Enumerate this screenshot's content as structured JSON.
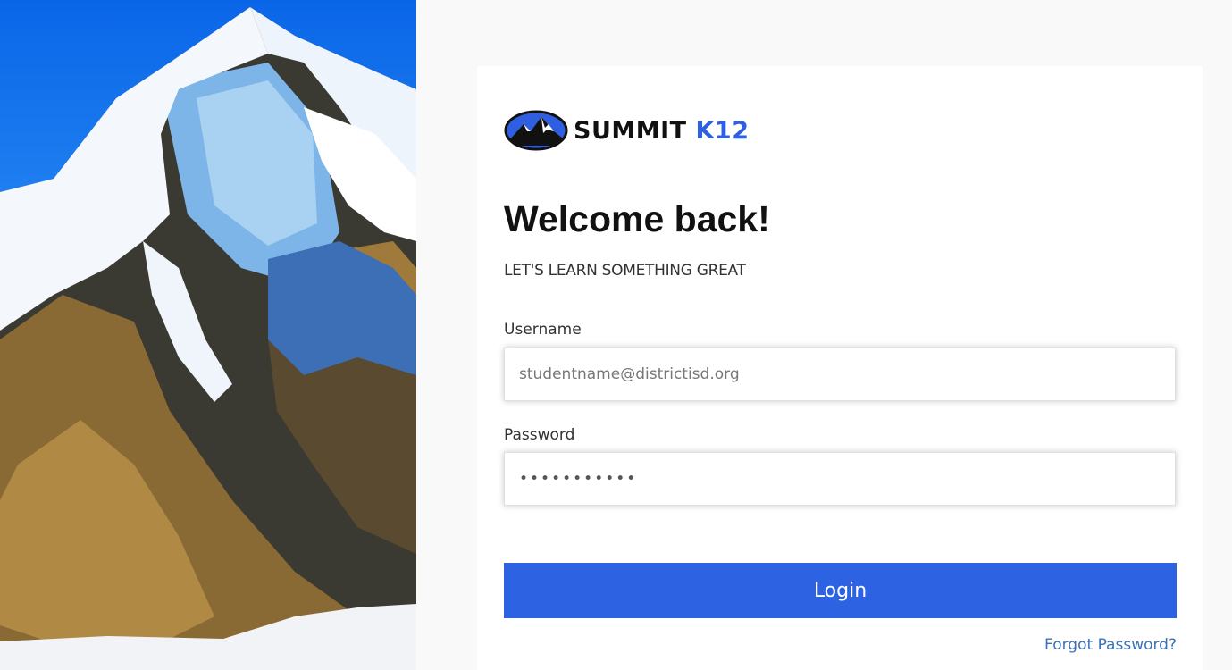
{
  "brand": {
    "name_prefix": "SUMMIT",
    "name_suffix": "K12",
    "logo_icon": "mountain-logo-icon",
    "accent_color": "#2d5fe0"
  },
  "hero": {
    "image": "snowy-mountain-peak-photo"
  },
  "welcome": {
    "title": "Welcome back!",
    "subtitle": "LET'S LEARN SOMETHING GREAT"
  },
  "form": {
    "username": {
      "label": "Username",
      "value": "",
      "placeholder": "studentname@districtisd.org"
    },
    "password": {
      "label": "Password",
      "value": "•••••••••••"
    },
    "login_label": "Login",
    "login_color": "#2d63e3",
    "forgot_label": "Forgot Password?",
    "forgot_color": "#3a72b8"
  }
}
